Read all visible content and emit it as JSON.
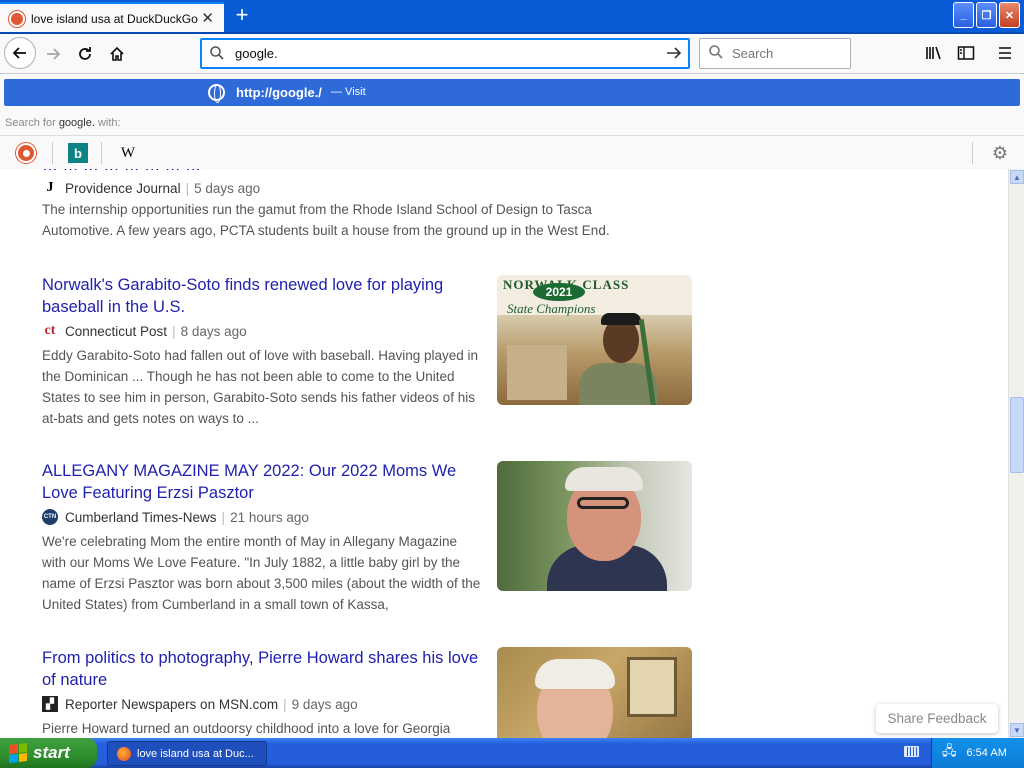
{
  "browser": {
    "tab_title": "love island usa at DuckDuckGo",
    "url_input": "google.",
    "search_placeholder": "Search",
    "popup": {
      "url": "http://google./",
      "action": "— Visit",
      "search_for_prefix": "Search for",
      "search_for_term": "google.",
      "search_for_suffix": "with:"
    }
  },
  "page": {
    "first_result": {
      "partial_title": "… … … … … … … …",
      "source": "Providence Journal",
      "ago": "5 days ago",
      "snippet": "The internship opportunities run the gamut from the Rhode Island School of Design to Tasca Automotive. A few years ago, PCTA students built a house from the ground up in the West End."
    },
    "results": [
      {
        "title": "Norwalk's Garabito-Soto finds renewed love for playing baseball in the U.S.",
        "source": "Connecticut Post",
        "source_icon": "ct",
        "ago": "8 days ago",
        "snippet": "Eddy Garabito-Soto had fallen out of love with baseball. Having played in the Dominican ... Though he has not been able to come to the United States to see him in person, Garabito-Soto sends his father videos of his at-bats and gets notes on ways to ...",
        "thumb_text_top": "NORWALK CLASS",
        "thumb_badge": "2021",
        "thumb_text_sub": "State Champions"
      },
      {
        "title": "ALLEGANY MAGAZINE MAY 2022: Our 2022 Moms We Love Featuring Erzsi Pasztor",
        "source": "Cumberland Times-News",
        "source_icon": "CTN",
        "ago": "21 hours ago",
        "snippet": "We're celebrating Mom the entire month of May in Allegany Magazine with our Moms We Love Feature. \"In July 1882, a little baby girl by the name of Erzsi Pasztor was born about 3,500 miles (about the width of the United States) from Cumberland in a small town of Kassa,"
      },
      {
        "title": "From politics to photography, Pierre Howard shares his love of nature",
        "source": "Reporter Newspapers on MSN.com",
        "source_icon": "msn",
        "ago": "9 days ago",
        "snippet": "Pierre Howard turned an outdoorsy childhood into a love for Georgia"
      }
    ],
    "share_feedback": "Share Feedback"
  },
  "taskbar": {
    "start_label": "start",
    "task_label": "love island usa at Duc...",
    "clock": "6:54 AM"
  }
}
